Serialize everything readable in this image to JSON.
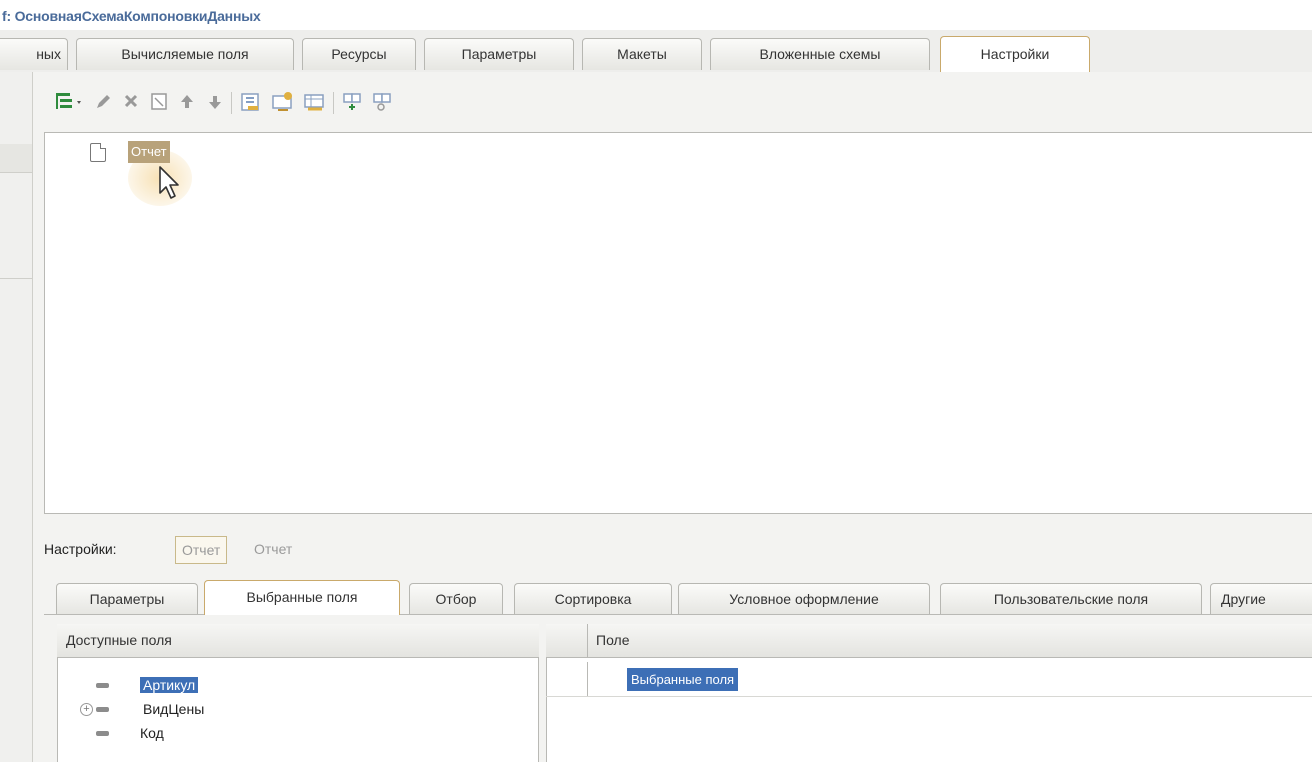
{
  "window": {
    "title": "f: ОсновнаяСхемаКомпоновкиДанных"
  },
  "top_tabs": [
    {
      "label": "ных",
      "active": false
    },
    {
      "label": "Вычисляемые поля",
      "active": false
    },
    {
      "label": "Ресурсы",
      "active": false
    },
    {
      "label": "Параметры",
      "active": false
    },
    {
      "label": "Макеты",
      "active": false
    },
    {
      "label": "Вложенные схемы",
      "active": false
    },
    {
      "label": "Настройки",
      "active": true
    }
  ],
  "toolbar": {
    "icons": [
      "add-structure-icon",
      "edit-icon",
      "delete-icon",
      "properties-icon",
      "move-up-icon",
      "move-down-icon",
      "group-icon",
      "detail-records-icon",
      "table-icon",
      "chart-icon",
      "nested-report-icon"
    ]
  },
  "structure_tree": {
    "items": [
      {
        "label": "Отчет",
        "selected": true
      }
    ]
  },
  "settings_bar": {
    "label": "Настройки:",
    "current_button": "Отчет",
    "current_text": "Отчет"
  },
  "settings_tabs": [
    {
      "label": "Параметры",
      "active": false
    },
    {
      "label": "Выбранные поля",
      "active": true
    },
    {
      "label": "Отбор",
      "active": false
    },
    {
      "label": "Сортировка",
      "active": false
    },
    {
      "label": "Условное оформление",
      "active": false
    },
    {
      "label": "Пользовательские поля",
      "active": false
    },
    {
      "label": "Другие",
      "active": false
    }
  ],
  "available_fields": {
    "header": "Доступные поля",
    "items": [
      {
        "label": "Артикул",
        "selected": true,
        "expandable": false
      },
      {
        "label": "ВидЦены",
        "selected": false,
        "expandable": true
      },
      {
        "label": "Код",
        "selected": false,
        "expandable": false
      }
    ]
  },
  "selected_fields": {
    "header": "Поле",
    "rows": [
      {
        "label": "Выбранные поля",
        "selected": true
      }
    ]
  },
  "colors": {
    "selection": "#3d6fb6",
    "tree_selection": "#b8a27a",
    "active_tab_border": "#c9a96b",
    "title": "#4a6b9a"
  }
}
